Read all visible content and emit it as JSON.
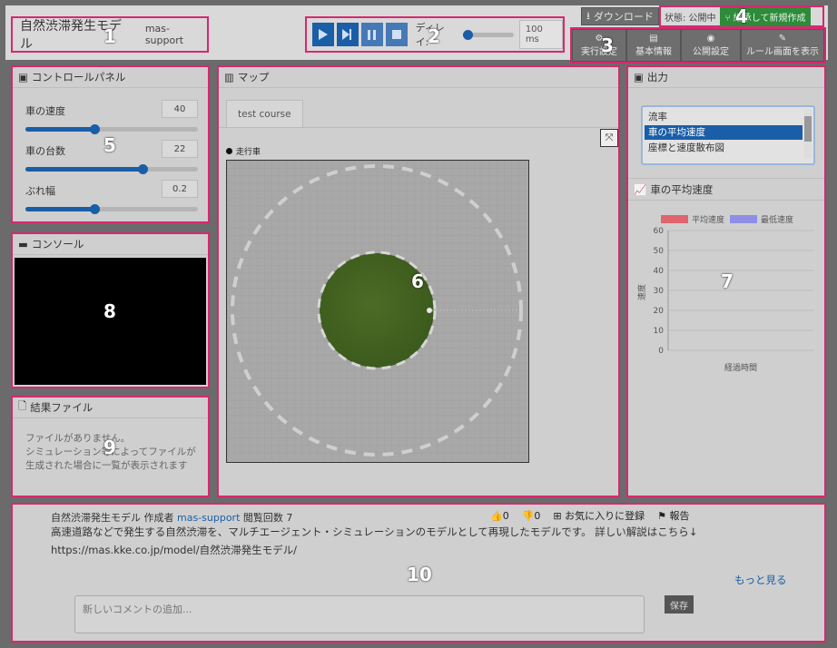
{
  "header": {
    "title": "自然渋滞発生モデル",
    "user": "mas-support"
  },
  "player": {
    "play_icon": "play-icon",
    "step_icon": "step-forward-icon",
    "pause_icon": "pause-icon",
    "stop_icon": "stop-icon",
    "delay_label": "ディレイ:",
    "delay_value": "100 ms",
    "delay_level": 0.1
  },
  "actions": {
    "download": "ダウンロード",
    "status": "状態: 公開中",
    "inherit": "継承して新規作成",
    "run_settings": "実行設定",
    "basic_info": "基本情報",
    "public_settings": "公開設定",
    "rule_screen": "ルール画面を表示"
  },
  "control_panel": {
    "title": "コントロールパネル",
    "sliders": [
      {
        "label": "車の速度",
        "value": "40",
        "level": 0.4
      },
      {
        "label": "車の台数",
        "value": "22",
        "level": 0.68
      },
      {
        "label": "ぶれ幅",
        "value": "0.2",
        "level": 0.4
      }
    ]
  },
  "console": {
    "title": "コンソール"
  },
  "files": {
    "title": "結果ファイル",
    "empty_line1": "ファイルがありません。",
    "empty_line2": "シミュレーション等によってファイルが生成された場合に一覧が表示されます"
  },
  "map": {
    "title": "マップ",
    "tab": "test course",
    "legend": "走行車"
  },
  "output": {
    "title": "出力",
    "options": [
      "流率",
      "車の平均速度",
      "座標と速度散布図"
    ],
    "selected": 1
  },
  "chart_data": {
    "type": "line",
    "title": "車の平均速度",
    "series": [
      {
        "name": "平均速度",
        "color": "#e0656f",
        "values": []
      },
      {
        "name": "最低速度",
        "color": "#8e8ee6",
        "values": []
      }
    ],
    "ylim": [
      0,
      60
    ],
    "yticks": [
      "60",
      "50",
      "40",
      "30",
      "20",
      "10",
      "0"
    ],
    "xlabel": "経過時間",
    "ylabel": "速度"
  },
  "footer": {
    "model_name": "自然渋滞発生モデル",
    "author_label": "作成者",
    "author": "mas-support",
    "views": "閲覧回数 7",
    "likes": "0",
    "dislikes": "0",
    "favorite": "お気に入りに登録",
    "report": "報告",
    "description": "高速道路などで発生する自然渋滞を、マルチエージェント・シミュレーションのモデルとして再現したモデルです。 詳しい解説はこちら↓ https://mas.kke.co.jp/model/自然渋滞発生モデル/",
    "more": "もっと見る",
    "comment_placeholder": "新しいコメントの追加...",
    "save": "保存"
  },
  "labels": [
    "1",
    "2",
    "3",
    "4",
    "5",
    "6",
    "7",
    "8",
    "9",
    "10"
  ]
}
